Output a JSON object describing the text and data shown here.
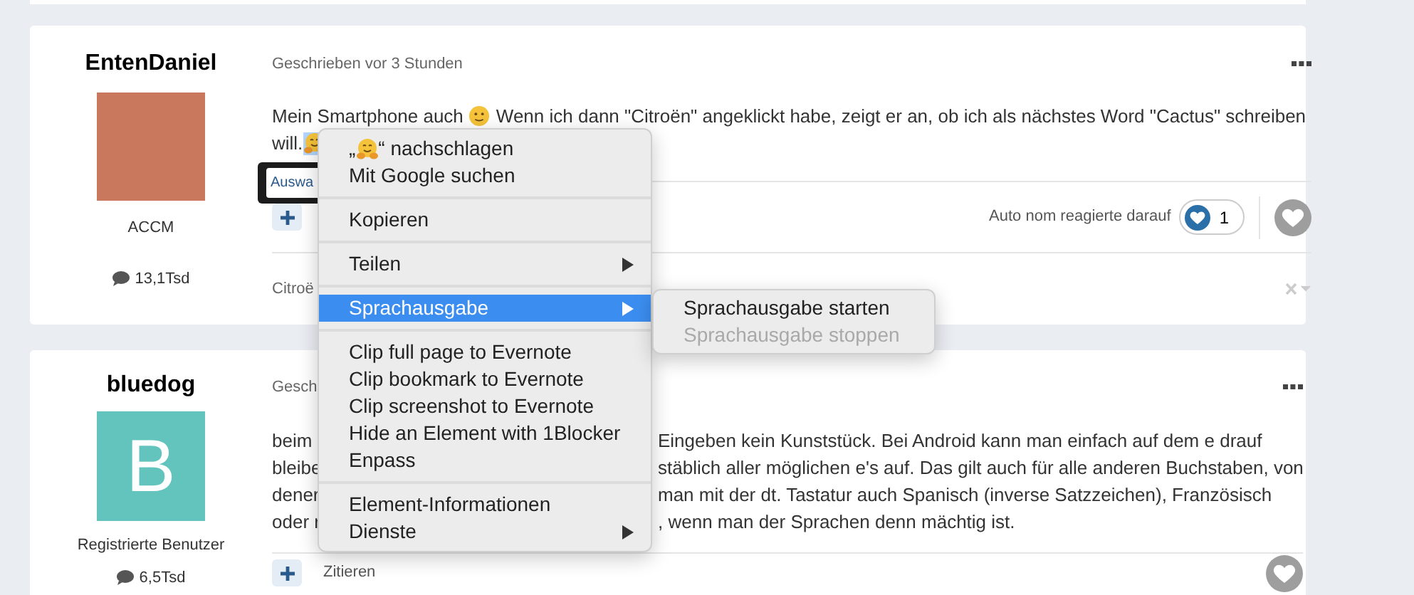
{
  "posts": [
    {
      "author": {
        "name": "EntenDaniel",
        "avatar": {
          "kind": "photo"
        },
        "rank": "ACCM",
        "posts_count": "13,1Tsd"
      },
      "meta": "Geschrieben vor 3 Stunden",
      "body": [
        {
          "segments": [
            {
              "kind": "text",
              "text": "Mein Smartphone auch"
            },
            {
              "kind": "smiley",
              "selected": false
            },
            {
              "kind": "text",
              "text": "Wenn ich dann \"Citroën\" angeklickt habe, zeigt er an, ob ich als nächstes Word \"Cactus\" schreiben"
            }
          ]
        },
        {
          "segments": [
            {
              "kind": "text",
              "text": "will."
            },
            {
              "kind": "hug",
              "selected": true
            }
          ]
        }
      ],
      "tooltip": "Auswa",
      "reactions": {
        "summary": "Auto nom reagierte darauf",
        "count": "1"
      },
      "footer_text": "Citroë"
    },
    {
      "author": {
        "name": "bluedog",
        "avatar": {
          "kind": "letter",
          "letter": "B"
        },
        "rank": "Registrierte Benutzer",
        "posts_count": "6,5Tsd"
      },
      "meta": "Gesch",
      "fragments": [
        {
          "left": "beim",
          "right": "Eingeben kein Kunststück. Bei Android kann man einfach auf dem e drauf"
        },
        {
          "left": "bleibe",
          "right": "stäblich aller möglichen e's auf. Das gilt auch für alle anderen Buchstaben, von"
        },
        {
          "left": "dener",
          "right": "man mit der dt. Tastatur auch Spanisch (inverse Satzzeichen), Französisch"
        },
        {
          "left": "oder r",
          "right": ", wenn man der Sprachen denn mächtig ist."
        }
      ],
      "quote_label": "Zitieren"
    }
  ],
  "menu": {
    "items": [
      {
        "kind": "lookup",
        "prefix": "„",
        "suffix": "“ nachschlagen",
        "submenu": false,
        "selected": false
      },
      {
        "kind": "item",
        "label": "Mit Google suchen",
        "submenu": false,
        "selected": false
      },
      {
        "kind": "separator"
      },
      {
        "kind": "item",
        "label": "Kopieren",
        "submenu": false,
        "selected": false
      },
      {
        "kind": "separator"
      },
      {
        "kind": "item",
        "label": "Teilen",
        "submenu": true,
        "selected": false
      },
      {
        "kind": "separator"
      },
      {
        "kind": "item",
        "label": "Sprachausgabe",
        "submenu": true,
        "selected": true
      },
      {
        "kind": "separator"
      },
      {
        "kind": "item",
        "label": "Clip full page to Evernote",
        "submenu": false,
        "selected": false
      },
      {
        "kind": "item",
        "label": "Clip bookmark to Evernote",
        "submenu": false,
        "selected": false
      },
      {
        "kind": "item",
        "label": "Clip screenshot to Evernote",
        "submenu": false,
        "selected": false
      },
      {
        "kind": "item",
        "label": "Hide an Element with 1Blocker",
        "submenu": false,
        "selected": false
      },
      {
        "kind": "item",
        "label": "Enpass",
        "submenu": false,
        "selected": false
      },
      {
        "kind": "separator"
      },
      {
        "kind": "item",
        "label": "Element-Informationen",
        "submenu": false,
        "selected": false
      },
      {
        "kind": "item",
        "label": "Dienste",
        "submenu": true,
        "selected": false
      }
    ]
  },
  "submenu": {
    "items": [
      {
        "label": "Sprachausgabe starten",
        "disabled": false
      },
      {
        "label": "Sprachausgabe stoppen",
        "disabled": true
      }
    ]
  }
}
